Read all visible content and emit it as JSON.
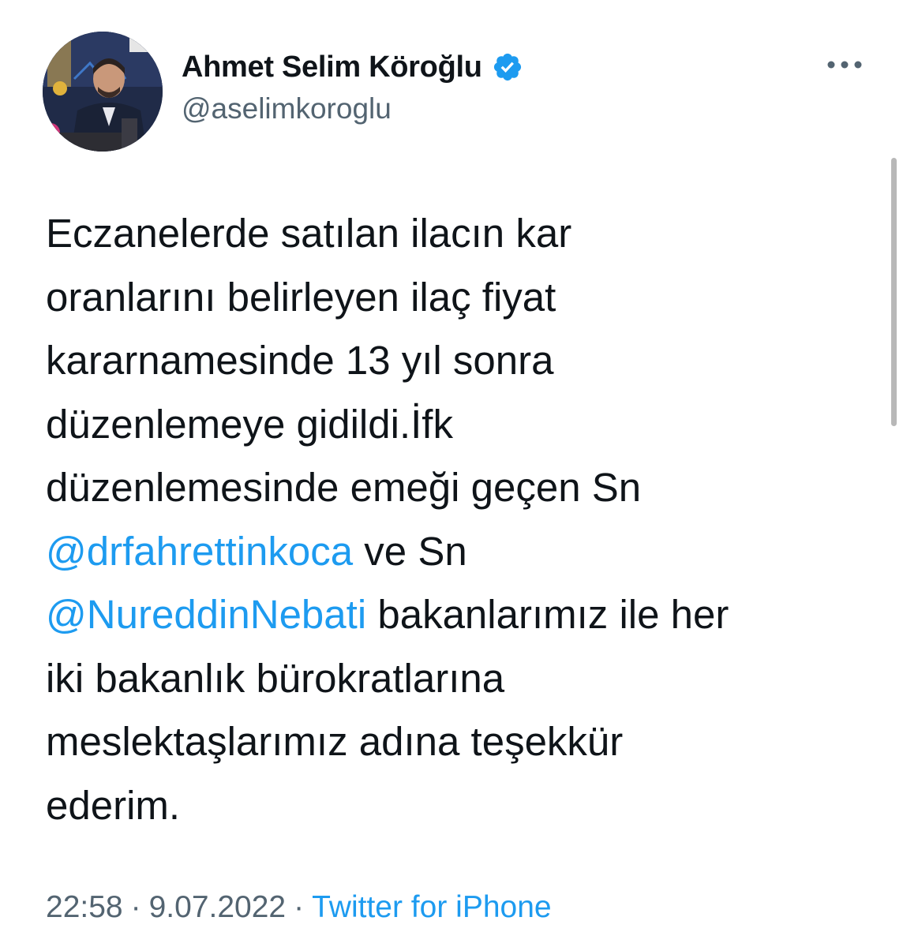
{
  "author": {
    "display_name": "Ahmet Selim Köroğlu",
    "handle": "@aselimkoroglu",
    "verified": true,
    "avatar_icon": "profile-photo"
  },
  "more_icon": "more-horizontal-icon",
  "tweet": {
    "line1": "Eczanelerde satılan ilacın kar",
    "line2": "oranlarını belirleyen ilaç fiyat",
    "line3": "kararnamesinde 13 yıl sonra",
    "line4": "düzenlemeye gidildi.İfk",
    "line5": "düzenlemesinde emeği geçen Sn",
    "mention1": "@drfahrettinkoca",
    "line6_rest": " ve Sn",
    "mention2": "@NureddinNebati",
    "line7_rest": " bakanlarımız ile her",
    "line8": "iki bakanlık bürokratlarına",
    "line9": "meslektaşlarımız adına teşekkür",
    "line10": "ederim."
  },
  "meta": {
    "time": "22:58",
    "separator": "·",
    "date": "9.07.2022",
    "source": "Twitter for iPhone"
  },
  "colors": {
    "link": "#1d9bf0",
    "secondary": "#536471",
    "text": "#0f1419"
  }
}
